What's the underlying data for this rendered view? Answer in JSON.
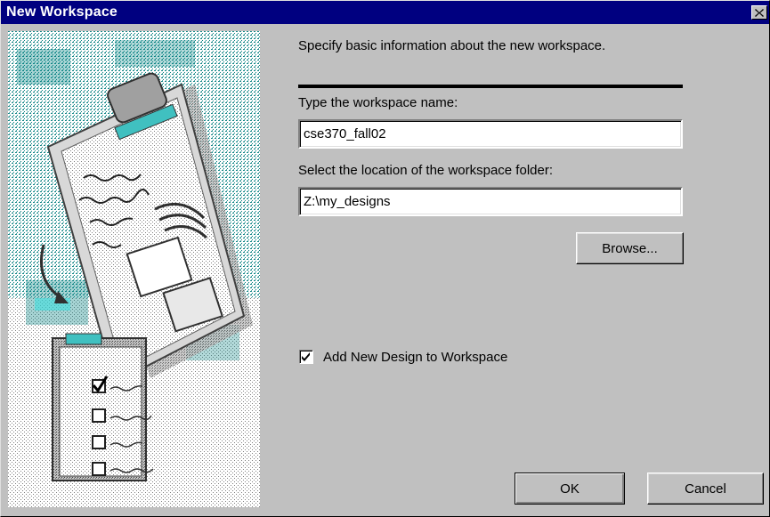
{
  "window": {
    "title": "New Workspace",
    "close_glyph": "✕"
  },
  "main": {
    "intro": "Specify basic information about the new workspace.",
    "name_label": "Type the workspace name:",
    "name_value": "cse370_fall02",
    "location_label": "Select the location of the workspace folder:",
    "location_value": "Z:\\my_designs",
    "browse_label": "Browse...",
    "checkbox_label": "Add New Design to Workspace",
    "checkbox_checked": true
  },
  "footer": {
    "ok_label": "OK",
    "cancel_label": "Cancel"
  },
  "illustration": {
    "icon": "clipboard-checklist-illustration",
    "colors": [
      "#008080",
      "#40c0c0",
      "#808080",
      "#000000",
      "#ffffff"
    ]
  }
}
